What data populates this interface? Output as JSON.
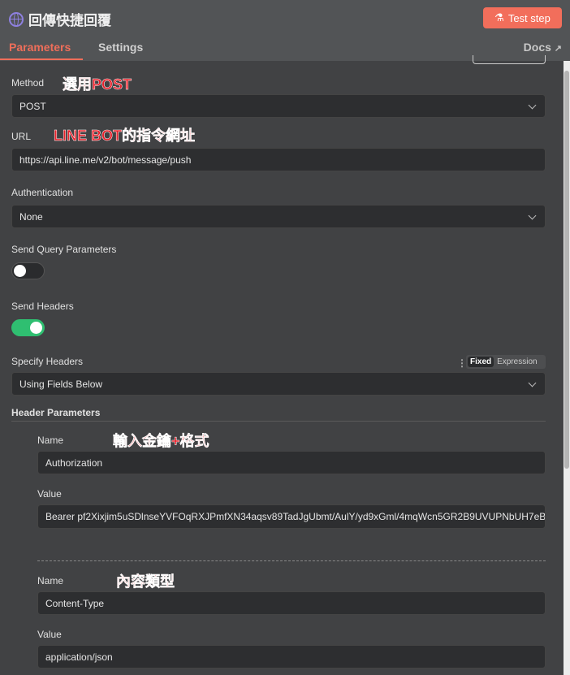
{
  "header": {
    "title": "回傳快捷回覆",
    "test_step": "Test step"
  },
  "tabs": {
    "parameters": "Parameters",
    "settings": "Settings",
    "docs": "Docs"
  },
  "method": {
    "label": "Method",
    "value": "POST",
    "annotation": "選用POST"
  },
  "url": {
    "label": "URL",
    "value": "https://api.line.me/v2/bot/message/push",
    "annotation": "LINE BOT的指令網址"
  },
  "auth": {
    "label": "Authentication",
    "value": "None"
  },
  "query": {
    "label": "Send Query Parameters",
    "enabled": false
  },
  "headers": {
    "label": "Send Headers",
    "enabled": true
  },
  "specify": {
    "label": "Specify Headers",
    "value": "Using Fields Below",
    "fixed": "Fixed",
    "expression": "Expression"
  },
  "header_params": {
    "label": "Header Parameters",
    "items": [
      {
        "name_label": "Name",
        "name": "Authorization",
        "value_label": "Value",
        "value": "Bearer pf2Xixjim5uSDlnseYVFOqRXJPmfXN34aqsv89TadJgUbmt/AulY/yd9xGml/4mqWcn5GR2B9UVUPNbUH7eB",
        "annotation": "輸入金鑰+格式"
      },
      {
        "name_label": "Name",
        "name": "Content-Type",
        "value_label": "Value",
        "value": "application/json",
        "annotation": "內容類型"
      }
    ]
  }
}
